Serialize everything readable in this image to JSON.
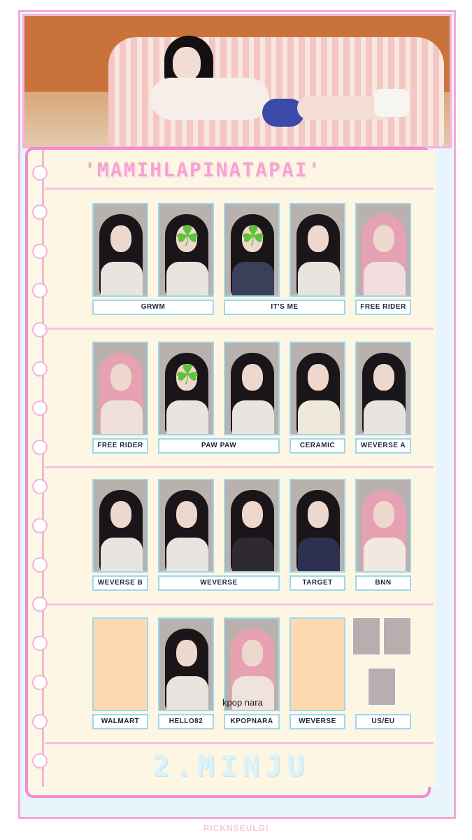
{
  "header": {
    "title": "'MAMIHLAPINATAPAI'"
  },
  "rows": [
    {
      "labels": [
        "GRWM",
        "IT'S ME",
        "FREE RIDER"
      ]
    },
    {
      "labels": [
        "FREE RIDER",
        "PAW PAW",
        "CERAMIC",
        "WEVERSE A"
      ]
    },
    {
      "labels": [
        "WEVERSE B",
        "WEVERSE",
        "TARGET",
        "BNN"
      ]
    },
    {
      "labels": [
        "WALMART",
        "HELLO82",
        "KPOPNARA",
        "WEVERSE",
        "US/EU"
      ]
    }
  ],
  "watermark": "kpop nara",
  "member": "2.MINJU",
  "credit": "RICKNSEULGI",
  "icons": {
    "clover": "four-leaf-clover-icon"
  },
  "colors": {
    "pink_border": "#f28ccd",
    "label_border": "#9ed8ec",
    "paper": "#fdf6e3",
    "background": "#e8f4fb",
    "blank_card": "#fdd9b0"
  }
}
